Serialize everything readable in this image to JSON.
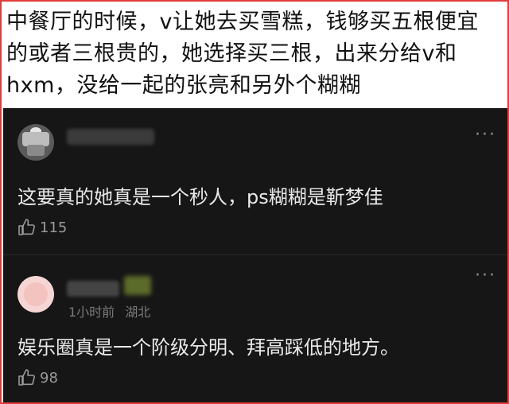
{
  "caption": {
    "line1": "中餐厅的时候，v让她去买雪糕，钱够买五根便宜",
    "line2": "的或者三根贵的，她选择买三根，出来分给v和",
    "line3": "hxm，没给一起的张亮和另外个糊糊"
  },
  "comments": [
    {
      "text": "这要真的她真是一个秒人，ps糊糊是靳梦佳",
      "likes": "115",
      "more_icon": "···"
    },
    {
      "time": "1小时前",
      "location": "湖北",
      "text": "娱乐圈真是一个阶级分明、拜高踩低的地方。",
      "likes": "98",
      "more_icon": "···"
    }
  ],
  "colors": {
    "frame_border": "#e23b3b",
    "comment_bg": "#161616",
    "comment_text": "#e9e9e9",
    "meta_text": "#7a7a7a"
  }
}
